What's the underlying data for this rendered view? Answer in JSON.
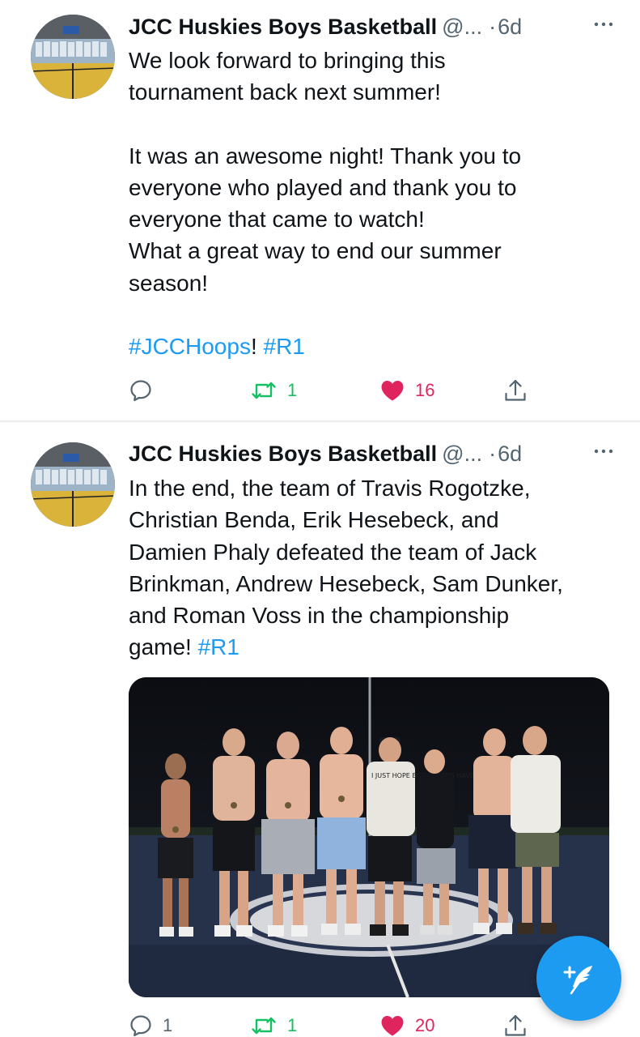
{
  "tweets": [
    {
      "author_name": "JCC Huskies Boys Basketball",
      "handle": "@...",
      "separator": "·",
      "time": "6d",
      "paragraphs": [
        {
          "lines": [
            {
              "text": "We look forward to bringing this"
            },
            {
              "text": "tournament back next summer!"
            }
          ]
        },
        {
          "lines": [
            {
              "text": "It was an awesome night! Thank you to"
            },
            {
              "text": "everyone who played and thank you to"
            },
            {
              "text": "everyone that came to watch!"
            },
            {
              "text": "What a great way to end our summer"
            },
            {
              "text": "season!"
            }
          ]
        }
      ],
      "hashtag_line": {
        "tag1": "#JCCHoops",
        "sep": "! ",
        "tag2": "#R1"
      },
      "reply_count": "",
      "retweet_count": "1",
      "like_count": "16",
      "liked": true
    },
    {
      "author_name": "JCC Huskies Boys Basketball",
      "handle": "@...",
      "separator": "·",
      "time": "6d",
      "lines": [
        "In the end, the team of Travis Rogotzke,",
        "Christian Benda, Erik Hesebeck, and",
        "Damien Phaly defeated the team of Jack",
        "Brinkman, Andrew Hesebeck, Sam Dunker,",
        "and Roman Voss in the championship"
      ],
      "last_line_text": "game! ",
      "last_line_tag": "#R1",
      "photo_shirt_text": "I JUST HOPE BOTH TEAMS HAVE FUN",
      "reply_count": "1",
      "retweet_count": "1",
      "like_count": "20",
      "liked": true
    }
  ],
  "colors": {
    "accent": "#1d9bf0",
    "retweet": "#17bf63",
    "like": "#e0245e",
    "muted": "#536471"
  },
  "icons": {
    "reply": "speech-bubble-icon",
    "retweet": "retweet-arrows-icon",
    "like": "heart-icon",
    "share": "share-upload-icon",
    "more": "more-dots-icon",
    "compose": "feather-plus-icon"
  }
}
